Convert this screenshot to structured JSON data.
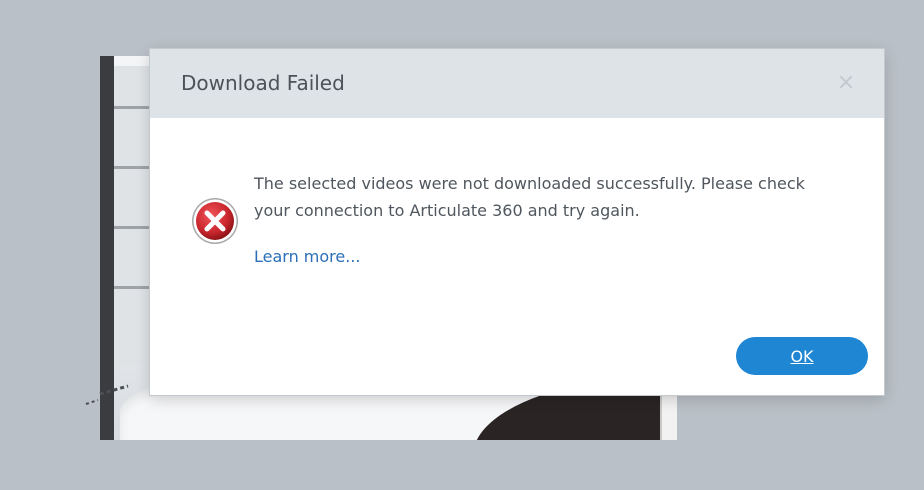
{
  "dialog": {
    "title": "Download Failed",
    "close_glyph": "×",
    "message": "The selected videos were not downloaded successfully. Please check your connection to Articulate 360 and try again.",
    "learn_more_label": "Learn more...",
    "ok_label": "OK",
    "icon": "error-x-icon"
  },
  "colors": {
    "header_bg": "#dee3e8",
    "ok_button": "#1e86d3",
    "link": "#2b6fb8",
    "error_icon": "#c8262c",
    "page_bg": "#b9c0c7"
  }
}
